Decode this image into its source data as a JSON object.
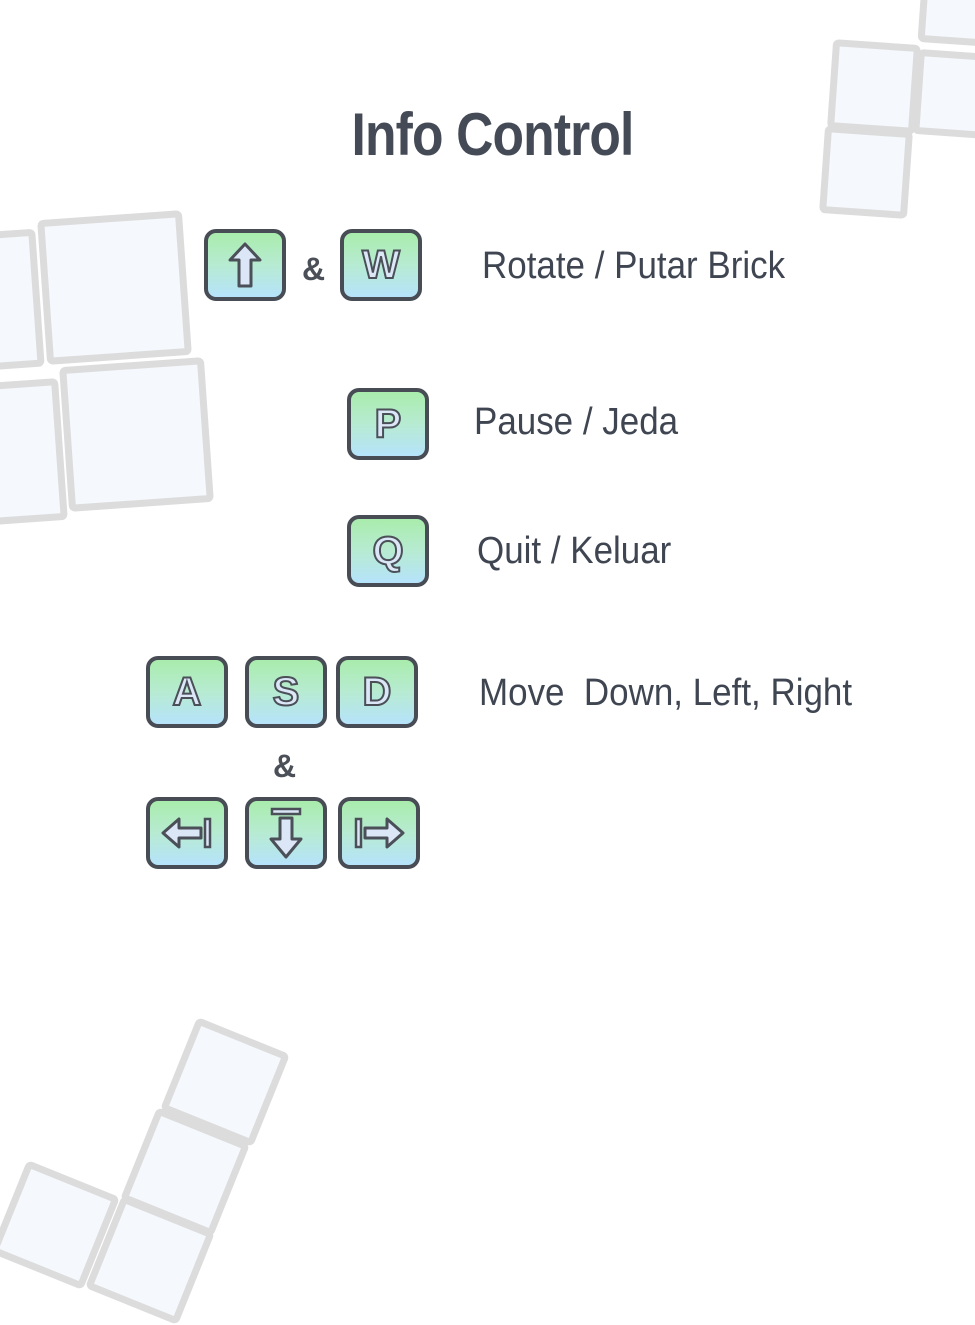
{
  "title": "Info Control",
  "rows": {
    "rotate": {
      "keys": [
        "↑",
        "W"
      ],
      "joiner": "&",
      "description": "Rotate / Putar Brick"
    },
    "pause": {
      "keys": [
        "P"
      ],
      "description": "Pause / Jeda"
    },
    "quit": {
      "keys": [
        "Q"
      ],
      "description": "Quit / Keluar"
    },
    "move": {
      "letter_keys": [
        "A",
        "S",
        "D"
      ],
      "joiner": "&",
      "arrow_keys": [
        "left-arrow-icon",
        "down-arrow-icon",
        "right-arrow-icon"
      ],
      "description": "Move  Down, Left, Right"
    }
  },
  "colors": {
    "key_top": "#a9ecac",
    "key_bottom": "#b6e3fb",
    "key_border": "#474c55",
    "text": "#3f4652",
    "brick_border": "#dcdcdc"
  }
}
